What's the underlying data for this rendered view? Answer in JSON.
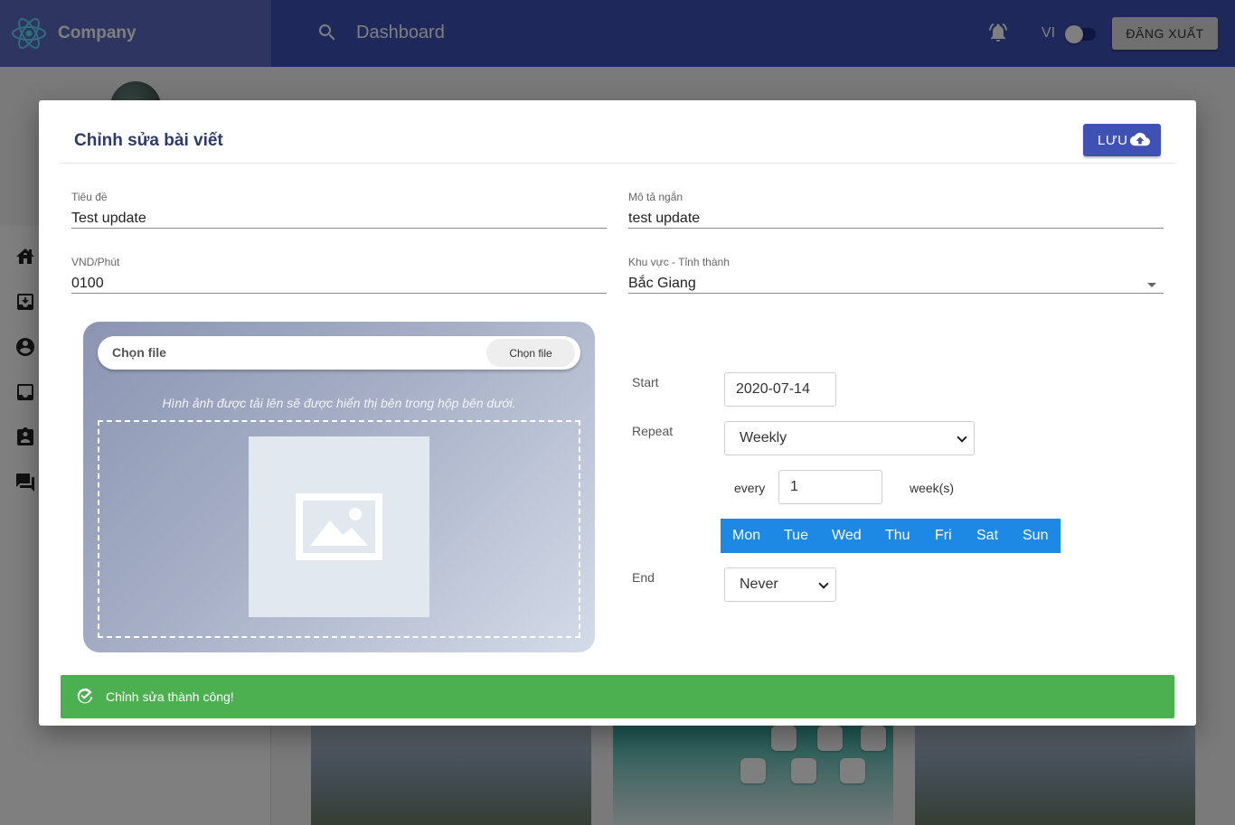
{
  "header": {
    "brand": "Company",
    "page_title": "Dashboard",
    "language": "VI",
    "logout_label": "ĐĂNG XUẤT"
  },
  "dialog": {
    "title": "Chỉnh sửa bài viết",
    "save_label": "LƯU",
    "fields": {
      "title": {
        "label": "Tiêu đề",
        "value": "Test update"
      },
      "short_desc": {
        "label": "Mô tả ngắn",
        "value": "test update"
      },
      "price": {
        "label": "VND/Phút",
        "value": "0100"
      },
      "region": {
        "label": "Khu vực - Tỉnh thành",
        "value": "Bắc Giang"
      }
    },
    "upload": {
      "file_name": "Chọn file",
      "button_label": "Chọn file",
      "hint": "Hình ảnh được tải lên sẽ được hiển thị bên trong hộp bên dưới."
    },
    "recurrence": {
      "start_label": "Start",
      "start_value": "2020-07-14",
      "repeat_label": "Repeat",
      "repeat_value": "Weekly",
      "every_label": "every",
      "every_value": "1",
      "unit_label": "week(s)",
      "days": [
        "Mon",
        "Tue",
        "Wed",
        "Thu",
        "Fri",
        "Sat",
        "Sun"
      ],
      "end_label": "End",
      "end_value": "Never"
    },
    "snackbar": {
      "message": "Chỉnh sửa thành công!"
    }
  },
  "colors": {
    "primary": "#3f51b5",
    "day_bar": "#1e88e5",
    "success": "#4caf50"
  }
}
